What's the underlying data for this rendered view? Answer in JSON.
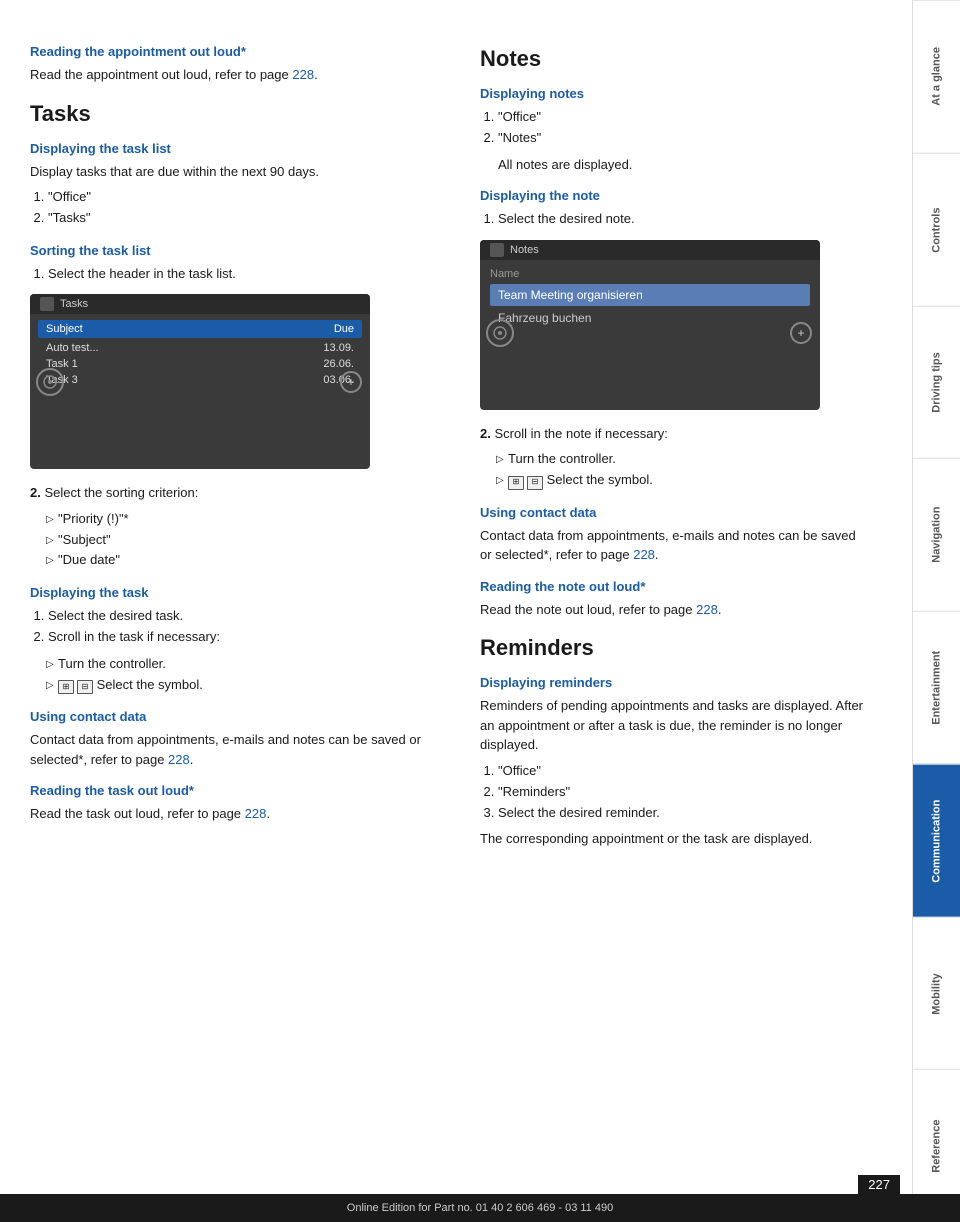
{
  "left": {
    "top_section": {
      "heading": "Reading the appointment out loud*",
      "body": "Read the appointment out loud, refer to page",
      "link": "228",
      "link_suffix": "."
    },
    "tasks": {
      "title": "Tasks",
      "subsections": [
        {
          "id": "displaying-task-list",
          "heading": "Displaying the task list",
          "body": "Display tasks that are due within the next 90 days.",
          "list": [
            "\"Office\"",
            "\"Tasks\""
          ]
        },
        {
          "id": "sorting-task-list",
          "heading": "Sorting the task list",
          "steps": [
            "Select the header in the task list."
          ],
          "step2_label": "2.",
          "step2_body": "Select the sorting criterion:",
          "sort_options": [
            "\"Priority (!)\"*",
            "\"Subject\"",
            "\"Due date\""
          ]
        },
        {
          "id": "displaying-task",
          "heading": "Displaying the task",
          "steps": [
            "Select the desired task.",
            "Scroll in the task if necessary:"
          ],
          "scroll_options": [
            "Turn the controller.",
            "&#x1F4F1; &#x1F4F1; Select the symbol."
          ]
        },
        {
          "id": "using-contact-data-tasks",
          "heading": "Using contact data",
          "body": "Contact data from appointments, e-mails and notes can be saved or selected*, refer to page",
          "link": "228",
          "link_suffix": "."
        },
        {
          "id": "reading-task-loud",
          "heading": "Reading the task out loud*",
          "body": "Read the task out loud, refer to page",
          "link": "228",
          "link_suffix": "."
        }
      ],
      "screenshot": {
        "title": "Tasks",
        "col1": "Subject",
        "col2": "Due",
        "rows": [
          {
            "subject": "Auto test...",
            "due": "13.09."
          },
          {
            "subject": "Task 1",
            "due": "26.06."
          },
          {
            "subject": "Task 3",
            "due": "03.06."
          }
        ]
      }
    }
  },
  "right": {
    "notes": {
      "title": "Notes",
      "subsections": [
        {
          "id": "displaying-notes",
          "heading": "Displaying notes",
          "list": [
            "\"Office\"",
            "\"Notes\""
          ],
          "after_list": "All notes are displayed."
        },
        {
          "id": "displaying-note",
          "heading": "Displaying the note",
          "steps": [
            "Select the desired note."
          ],
          "step2_label": "2.",
          "step2_body": "Scroll in the note if necessary:",
          "scroll_options": [
            "Turn the controller.",
            "Select the symbol."
          ]
        },
        {
          "id": "using-contact-data-notes",
          "heading": "Using contact data",
          "body": "Contact data from appointments, e-mails and notes can be saved or selected*, refer to page",
          "link": "228",
          "link_suffix": "."
        },
        {
          "id": "reading-note-loud",
          "heading": "Reading the note out loud*",
          "body": "Read the note out loud, refer to page",
          "link": "228",
          "link_suffix": "."
        }
      ],
      "screenshot": {
        "title": "Notes",
        "field_label": "Name",
        "selected_item": "Team Meeting organisieren",
        "normal_item": "Fahrzeug buchen"
      }
    },
    "reminders": {
      "title": "Reminders",
      "subsections": [
        {
          "id": "displaying-reminders",
          "heading": "Displaying reminders",
          "body": "Reminders of pending appointments and tasks are displayed. After an appointment or after a task is due, the reminder is no longer displayed.",
          "list": [
            "\"Office\"",
            "\"Reminders\"",
            "Select the desired reminder."
          ],
          "after_list": "The corresponding appointment or the task are displayed."
        }
      ]
    }
  },
  "sidebar": {
    "tabs": [
      {
        "label": "At a glance",
        "active": false
      },
      {
        "label": "Controls",
        "active": false
      },
      {
        "label": "Driving tips",
        "active": false
      },
      {
        "label": "Navigation",
        "active": false
      },
      {
        "label": "Entertainment",
        "active": false
      },
      {
        "label": "Communication",
        "active": true
      },
      {
        "label": "Mobility",
        "active": false
      },
      {
        "label": "Reference",
        "active": false
      }
    ]
  },
  "footer": {
    "text": "Online Edition for Part no. 01 40 2 606 469 - 03 11 490",
    "page_number": "227"
  }
}
